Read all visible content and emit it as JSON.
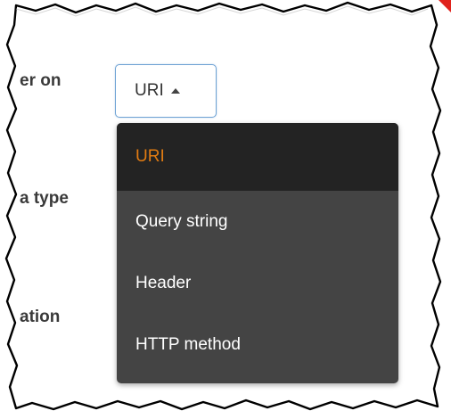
{
  "labels": {
    "row1": "er on",
    "row2": "a type",
    "row3": "ation"
  },
  "select": {
    "value": "URI",
    "caret_icon": "caret-up-icon"
  },
  "dropdown": {
    "items": [
      {
        "label": "URI",
        "selected": true
      },
      {
        "label": "Query string",
        "selected": false
      },
      {
        "label": "Header",
        "selected": false
      },
      {
        "label": "HTTP method",
        "selected": false
      }
    ]
  },
  "colors": {
    "menu_bg": "#444444",
    "menu_active_bg": "#232323",
    "menu_active_text": "#e07b12",
    "select_border": "#6ea2d4",
    "corner_accent": "#e0231d"
  }
}
